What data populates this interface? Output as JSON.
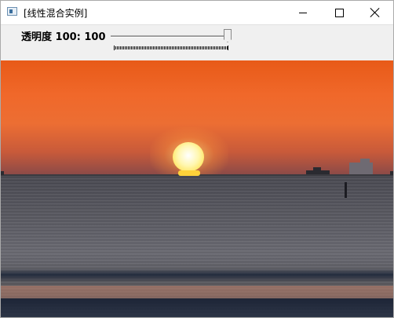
{
  "window": {
    "title": "[线性混合实例]",
    "icons": {
      "app": "app-window-icon",
      "minimize": "minimize-icon",
      "maximize": "maximize-icon",
      "close": "close-icon"
    }
  },
  "toolbar": {
    "trackbar_label": "透明度 100: 100",
    "trackbar_value": 100,
    "trackbar_max": 100
  },
  "image": {
    "description_icon": "sunset-over-sea-image"
  }
}
